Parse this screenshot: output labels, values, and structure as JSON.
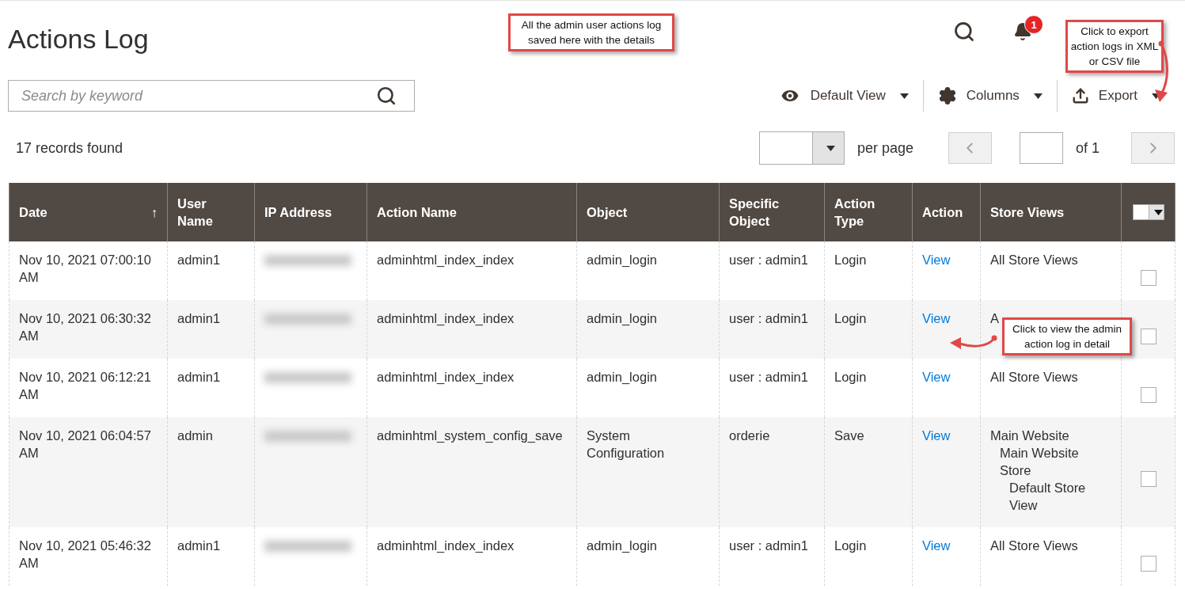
{
  "page": {
    "title": "Actions Log"
  },
  "header_actions": {
    "notification_count": "1"
  },
  "search": {
    "placeholder": "Search by keyword"
  },
  "toolbar": [
    {
      "kind": "view",
      "label": "Default View"
    },
    {
      "kind": "columns",
      "label": "Columns"
    },
    {
      "kind": "export",
      "label": "Export"
    }
  ],
  "records_found": "17 records found",
  "pager": {
    "per_page_label": "per page",
    "page_total": "of 1"
  },
  "table": {
    "columns": [
      {
        "label": "Date",
        "sort_indicator": "↑"
      },
      {
        "label": "User Name"
      },
      {
        "label": "IP Address"
      },
      {
        "label": "Action Name"
      },
      {
        "label": "Object"
      },
      {
        "label": "Specific Object"
      },
      {
        "label": "Action Type"
      },
      {
        "label": "Action"
      },
      {
        "label": "Store Views"
      }
    ],
    "rows": [
      {
        "date": "Nov 10, 2021 07:00:10 AM",
        "user": "admin1",
        "action_name": "adminhtml_index_index",
        "object": "admin_login",
        "specific_object": "user : admin1",
        "action_type": "Login",
        "action": "View",
        "store_views": [
          "All Store Views"
        ],
        "checked": false
      },
      {
        "date": "Nov 10, 2021 06:30:32 AM",
        "user": "admin1",
        "action_name": "adminhtml_index_index",
        "object": "admin_login",
        "specific_object": "user : admin1",
        "action_type": "Login",
        "action": "View",
        "store_views": [
          "A"
        ],
        "checked": false
      },
      {
        "date": "Nov 10, 2021 06:12:21 AM",
        "user": "admin1",
        "action_name": "adminhtml_index_index",
        "object": "admin_login",
        "specific_object": "user : admin1",
        "action_type": "Login",
        "action": "View",
        "store_views": [
          "All Store Views"
        ],
        "checked": false
      },
      {
        "date": "Nov 10, 2021 06:04:57 AM",
        "user": "admin",
        "action_name": "adminhtml_system_config_save",
        "object": "System Configuration",
        "specific_object": "orderie",
        "action_type": "Save",
        "action": "View",
        "store_views": [
          "Main Website",
          "Main Website Store",
          "Default Store View"
        ],
        "checked": false
      },
      {
        "date": "Nov 10, 2021 05:46:32 AM",
        "user": "admin1",
        "action_name": "adminhtml_index_index",
        "object": "admin_login",
        "specific_object": "user : admin1",
        "action_type": "Login",
        "action": "View",
        "store_views": [
          "All Store Views"
        ],
        "checked": false
      }
    ]
  },
  "callouts": [
    {
      "kind": "top",
      "text": "All the admin user actions log saved here with the details"
    },
    {
      "kind": "export",
      "text": "Click to export action logs in XML or CSV file"
    },
    {
      "kind": "view",
      "text": "Click to view the admin action log in detail"
    }
  ]
}
